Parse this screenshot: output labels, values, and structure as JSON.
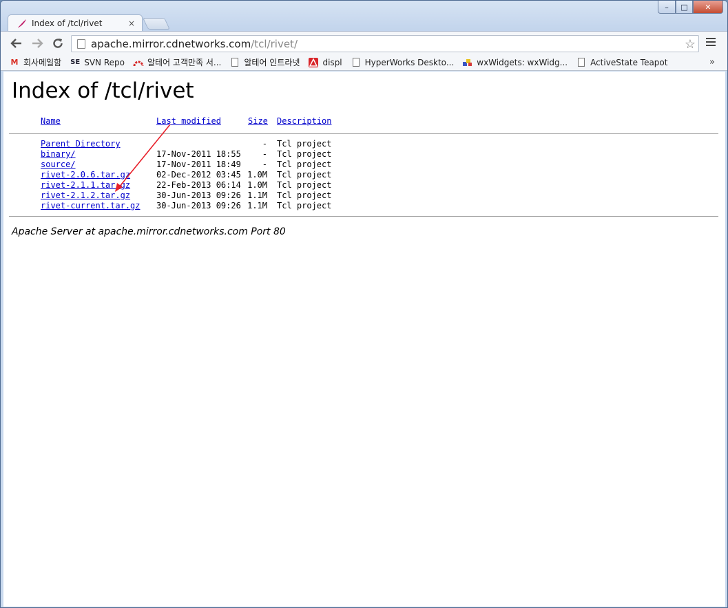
{
  "browser": {
    "tab_title": "Index of /tcl/rivet",
    "tab_close": "×",
    "window_controls": {
      "minimize": "–",
      "maximize": "□",
      "close": "✕"
    },
    "url_host": "apache.mirror.cdnetworks.com",
    "url_path": "/tcl/rivet/",
    "more_bookmarks": "»"
  },
  "bookmarks": [
    {
      "label": "회사메일함",
      "icon": "gmail-icon"
    },
    {
      "label": "SVN Repo",
      "icon": "svn-icon"
    },
    {
      "label": "알테어 고객만족 서...",
      "icon": "altair-icon"
    },
    {
      "label": "알테어 인트라넷",
      "icon": "page-icon"
    },
    {
      "label": "displ",
      "icon": "red-logo-icon"
    },
    {
      "label": "HyperWorks Deskto...",
      "icon": "page-icon"
    },
    {
      "label": "wxWidgets: wxWidg...",
      "icon": "wx-icon"
    },
    {
      "label": "ActiveState Teapot",
      "icon": "page-icon"
    }
  ],
  "page": {
    "title": "Index of /tcl/rivet",
    "headers": {
      "name": "Name",
      "modified": "Last modified",
      "size": "Size",
      "description": "Description"
    },
    "rows": [
      {
        "name": "Parent Directory",
        "modified": "",
        "size": "-",
        "description": "Tcl project"
      },
      {
        "name": "binary/",
        "modified": "17-Nov-2011 18:55",
        "size": "-",
        "description": "Tcl project"
      },
      {
        "name": "source/",
        "modified": "17-Nov-2011 18:49",
        "size": "-",
        "description": "Tcl project"
      },
      {
        "name": "rivet-2.0.6.tar.gz",
        "modified": "02-Dec-2012 03:45",
        "size": "1.0M",
        "description": "Tcl project"
      },
      {
        "name": "rivet-2.1.1.tar.gz",
        "modified": "22-Feb-2013 06:14",
        "size": "1.0M",
        "description": "Tcl project"
      },
      {
        "name": "rivet-2.1.2.tar.gz",
        "modified": "30-Jun-2013 09:26",
        "size": "1.1M",
        "description": "Tcl project"
      },
      {
        "name": "rivet-current.tar.gz",
        "modified": "30-Jun-2013 09:26",
        "size": "1.1M",
        "description": "Tcl project"
      }
    ],
    "footer": "Apache Server at apache.mirror.cdnetworks.com Port 80"
  },
  "annotation": {
    "color": "#e8202a"
  }
}
